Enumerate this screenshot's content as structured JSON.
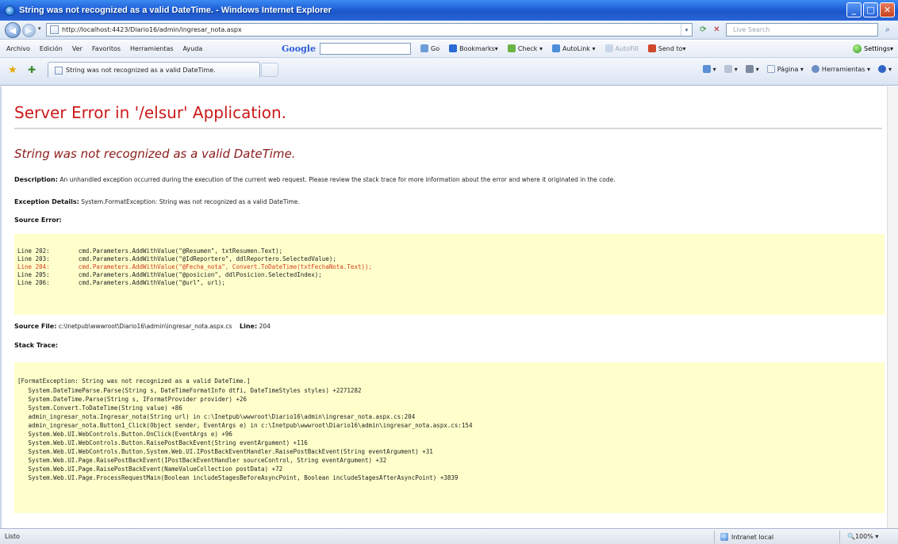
{
  "window": {
    "title": "String was not recognized as a valid DateTime. - Windows Internet Explorer",
    "buttons": [
      "_",
      "□",
      "✕"
    ]
  },
  "address_bar": {
    "url": "http://localhost:4423/Diario16/admin/ingresar_nota.aspx",
    "search_placeholder": "Live Search"
  },
  "menu": {
    "items": [
      "Archivo",
      "Edición",
      "Ver",
      "Favoritos",
      "Herramientas",
      "Ayuda"
    ],
    "google_logo": "Google",
    "google_items": [
      "Go",
      "Bookmarks▾",
      "Check ▾",
      "AutoLink ▾",
      "AutoFill",
      "Send to▾"
    ],
    "settings": "Settings▾"
  },
  "tab": {
    "label": "String was not recognized as a valid DateTime.",
    "commands": [
      "Página ▾",
      "Herramientas ▾"
    ]
  },
  "page": {
    "server_error": "Server Error in '/elsur' Application.",
    "error_title": "String was not recognized as a valid DateTime.",
    "description_label": "Description:",
    "description_text": "An unhandled exception occurred during the execution of the current web request. Please review the stack trace for more information about the error and where it originated in the code.",
    "exception_label": "Exception Details:",
    "exception_text": "System.FormatException: String was not recognized as a valid DateTime.",
    "source_error_label": "Source Error:",
    "source_lines": [
      {
        "num": "Line 202:",
        "code": "cmd.Parameters.AddWithValue(\"@Resumen\", txtResumen.Text);",
        "error": false
      },
      {
        "num": "Line 203:",
        "code": "cmd.Parameters.AddWithValue(\"@IdReportero\", ddlReportero.SelectedValue);",
        "error": false
      },
      {
        "num": "Line 204:",
        "code": "cmd.Parameters.AddWithValue(\"@Fecha_nota\", Convert.ToDateTime(txtFechaNota.Text));",
        "error": true
      },
      {
        "num": "Line 205:",
        "code": "cmd.Parameters.AddWithValue(\"@posicion\", ddlPosicion.SelectedIndex);",
        "error": false
      },
      {
        "num": "Line 206:",
        "code": "cmd.Parameters.AddWithValue(\"@url\", url);",
        "error": false
      }
    ],
    "source_file_label": "Source File:",
    "source_file": "c:\\Inetpub\\wwwroot\\Diario16\\admin\\ingresar_nota.aspx.cs",
    "line_label": "Line:",
    "line_value": "204",
    "stack_trace_label": "Stack Trace:",
    "stack_lines": [
      "[FormatException: String was not recognized as a valid DateTime.]",
      "   System.DateTimeParse.Parse(String s, DateTimeFormatInfo dtfi, DateTimeStyles styles) +2271282",
      "   System.DateTime.Parse(String s, IFormatProvider provider) +26",
      "   System.Convert.ToDateTime(String value) +86",
      "   admin_ingresar_nota.Ingresar_nota(String url) in c:\\Inetpub\\wwwroot\\Diario16\\admin\\ingresar_nota.aspx.cs:204",
      "   admin_ingresar_nota.Button1_Click(Object sender, EventArgs e) in c:\\Inetpub\\wwwroot\\Diario16\\admin\\ingresar_nota.aspx.cs:154",
      "   System.Web.UI.WebControls.Button.OnClick(EventArgs e) +96",
      "   System.Web.UI.WebControls.Button.RaisePostBackEvent(String eventArgument) +116",
      "   System.Web.UI.WebControls.Button.System.Web.UI.IPostBackEventHandler.RaisePostBackEvent(String eventArgument) +31",
      "   System.Web.UI.Page.RaisePostBackEvent(IPostBackEventHandler sourceControl, String eventArgument) +32",
      "   System.Web.UI.Page.RaisePostBackEvent(NameValueCollection postData) +72",
      "   System.Web.UI.Page.ProcessRequestMain(Boolean includeStagesBeforeAsyncPoint, Boolean includeStagesAfterAsyncPoint) +3839"
    ]
  },
  "status": {
    "left": "Listo",
    "zone": "Intranet local",
    "zoom": "100%"
  },
  "colors": {
    "server_error": "#cc1a1a",
    "error_title": "#8b1b1b",
    "code_background": "#ffffcc",
    "error_line": "#d23c1c",
    "titlebar": "#1f5fd8"
  }
}
